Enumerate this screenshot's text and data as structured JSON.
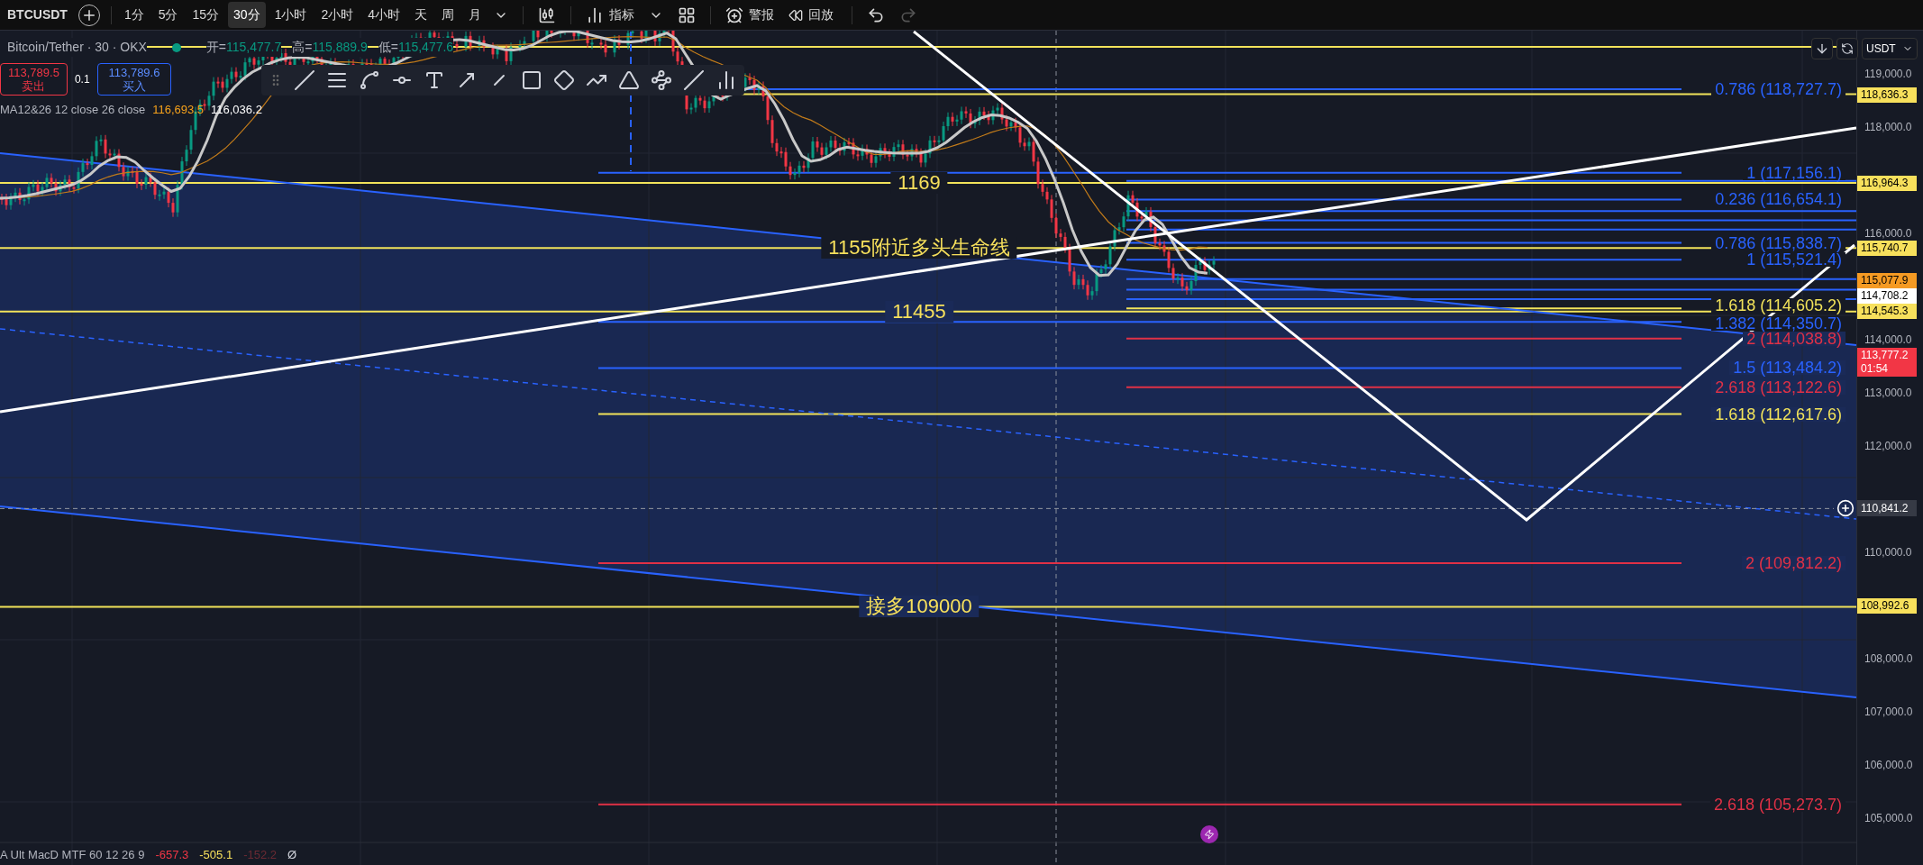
{
  "toolbar": {
    "symbol": "BTCUSDT",
    "intervals": [
      {
        "label": "1分",
        "selected": false
      },
      {
        "label": "5分",
        "selected": false
      },
      {
        "label": "15分",
        "selected": false
      },
      {
        "label": "30分",
        "selected": true
      },
      {
        "label": "1小时",
        "selected": false
      },
      {
        "label": "2小时",
        "selected": false
      },
      {
        "label": "4小时",
        "selected": false
      },
      {
        "label": "天",
        "selected": false
      },
      {
        "label": "周",
        "selected": false
      },
      {
        "label": "月",
        "selected": false
      }
    ],
    "indicators_label": "指标",
    "alerts_label": "警报",
    "replay_label": "回放",
    "redo_disabled": true
  },
  "legend": {
    "title": "Bitcoin/Tether · 30 · OKX",
    "ohlc": [
      {
        "label": "开=",
        "value": "115,477.7"
      },
      {
        "label": "高=",
        "value": "115,889.9"
      },
      {
        "label": "低=",
        "value": "115,477.6"
      }
    ]
  },
  "trade": {
    "sell_price": "113,789.5",
    "sell_label": "卖出",
    "quantity": "0.1",
    "buy_price": "113,789.6",
    "buy_label": "买入"
  },
  "ma": {
    "label": "MA12&26 12 close 26 close",
    "values": [
      {
        "value": "116,693.5",
        "color": "#f7a21b"
      },
      {
        "value": "116,036.2",
        "color": "#ffffff"
      }
    ]
  },
  "currency": "USDT",
  "annotations": [
    "1169",
    "1155附近多头生命线",
    "11455",
    "接多109000"
  ],
  "fib_levels": [
    {
      "label": "0.786 (118,727.7)",
      "color": "#2962ff"
    },
    {
      "label": "1 (117,156.1)",
      "color": "#2962ff"
    },
    {
      "label": "0.236 (116,654.1)",
      "color": "#2962ff"
    },
    {
      "label": "0.786 (115,838.7)",
      "color": "#2962ff"
    },
    {
      "label": "1 (115,521.4)",
      "color": "#2962ff"
    },
    {
      "label": "1.618 (114,605.2)",
      "color": "#f2e35a"
    },
    {
      "label": "1.382 (114,350.7)",
      "color": "#2962ff"
    },
    {
      "label": "2 (114,038.8)",
      "color": "#e03146"
    },
    {
      "label": "1.5 (113,484.2)",
      "color": "#2962ff"
    },
    {
      "label": "2.618 (113,122.6)",
      "color": "#e03146"
    },
    {
      "label": "1.618 (112,617.6)",
      "color": "#f2e35a"
    },
    {
      "label": "2 (109,812.2)",
      "color": "#e03146"
    },
    {
      "label": "2.618 (105,273.7)",
      "color": "#e03146"
    }
  ],
  "price_ticks": [
    "119,000.0",
    "118,000.0",
    "116,000.0",
    "114,000.0",
    "113,000.0",
    "112,000.0",
    "110,000.0",
    "108,000.0",
    "107,000.0",
    "106,000.0",
    "105,000.0"
  ],
  "price_tags": [
    {
      "value": "118,636.3",
      "color": "#f7e05c"
    },
    {
      "value": "116,964.3",
      "color": "#f7e05c"
    },
    {
      "value": "115,740.7",
      "color": "#f7e05c"
    },
    {
      "value": "115,077.9",
      "color": "#f59a23"
    },
    {
      "value": "114,708.2",
      "color": "#ffffff"
    },
    {
      "value": "114,545.3",
      "color": "#f7e05c"
    },
    {
      "value": "113,777.2",
      "countdown": "01:54",
      "color": "#f23645"
    },
    {
      "value": "108,992.6",
      "color": "#f7e05c"
    }
  ],
  "crosshair_price": "110,841.2",
  "macd": {
    "label": "A Ult MacD MTF 60 12 26 9",
    "values": [
      {
        "value": "-657.3",
        "color": "#f23645"
      },
      {
        "value": "-505.1",
        "color": "#f7e05c"
      },
      {
        "value": "-152.2",
        "color": "#6b2a33"
      }
    ],
    "extra": "Ø"
  }
}
